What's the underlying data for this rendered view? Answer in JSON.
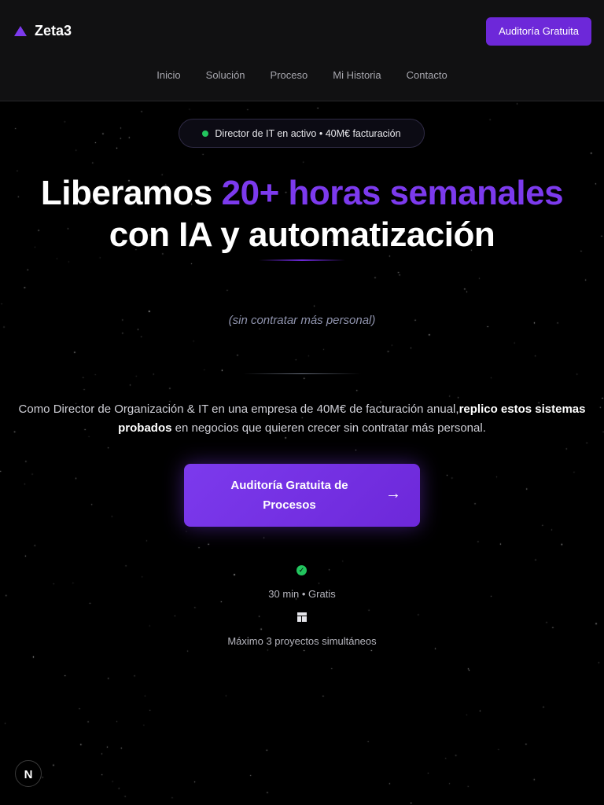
{
  "header": {
    "logo_text": "Zeta3",
    "cta_label": "Auditoría Gratuita",
    "nav": [
      "Inicio",
      "Solución",
      "Proceso",
      "Mi Historia",
      "Contacto"
    ]
  },
  "hero": {
    "badge": "Director de IT en activo • 40M€ facturación",
    "headline_part1": "Liberamos ",
    "headline_accent": "20+ horas semanales",
    "headline_part2": "con IA y automatización",
    "subtitle": "(sin contratar más personal)",
    "description_prefix": "Como Director de Organización & IT en una empresa de 40M€ de facturación anual,",
    "description_bold": "replico estos sistemas probados",
    "description_suffix": " en negocios que quieren crecer sin contratar más personal.",
    "cta_label": "Auditoría Gratuita de Procesos",
    "cta_arrow": "→",
    "meta_duration": "30 min • Gratis",
    "meta_capacity": "Máximo 3 proyectos simultáneos"
  },
  "dev_badge": "N",
  "colors": {
    "background": "#000000",
    "header_bg": "#111112",
    "accent": "#7c3aed",
    "button": "#6d28d9",
    "success": "#22c55e"
  },
  "icons": {
    "logo": "triangle-logo-icon",
    "check": "check-circle-icon",
    "layout": "layout-icon",
    "arrow": "arrow-right-icon"
  }
}
